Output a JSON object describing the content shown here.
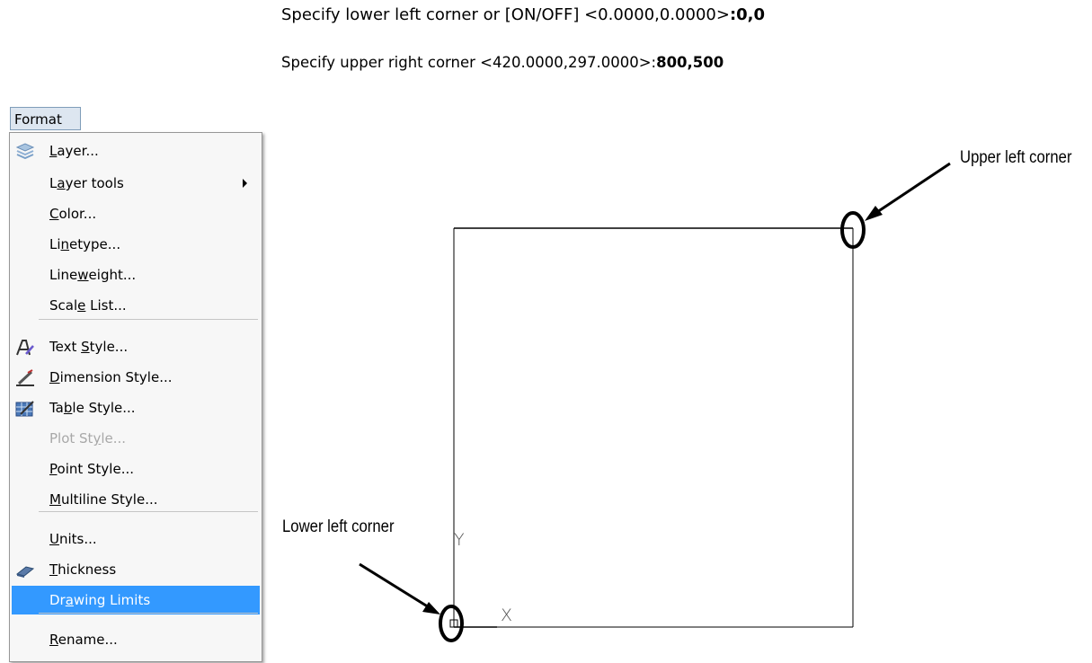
{
  "command": {
    "line1_text": "Specify lower left corner or [ON/OFF] <0.0000,0.0000>",
    "line1_value": ":0,0",
    "line2_text": "Specify upper right corner <420.0000,297.0000>:",
    "line2_value": "800,500"
  },
  "menubar": {
    "format_label": "Format"
  },
  "menu": {
    "items": [
      {
        "label": "Layer...",
        "mnemonic": "L",
        "icon": "layers-icon",
        "enabled": true
      },
      {
        "label": "Layer tools",
        "mnemonic": "a",
        "has_submenu": true,
        "enabled": true
      },
      {
        "label": "Color...",
        "mnemonic": "C",
        "enabled": true
      },
      {
        "label": "Linetype...",
        "mnemonic": "n",
        "enabled": true
      },
      {
        "label": "Lineweight...",
        "mnemonic": "w",
        "enabled": true
      },
      {
        "label": "Scale List...",
        "mnemonic": "e",
        "enabled": true
      },
      {
        "label": "Text Style...",
        "mnemonic": "S",
        "icon": "text-style-icon",
        "enabled": true
      },
      {
        "label": "Dimension Style...",
        "mnemonic": "D",
        "icon": "dimension-style-icon",
        "enabled": true
      },
      {
        "label": "Table Style...",
        "mnemonic": "b",
        "icon": "table-style-icon",
        "enabled": true
      },
      {
        "label": "Plot Style...",
        "mnemonic": "y",
        "enabled": false
      },
      {
        "label": "Point Style...",
        "mnemonic": "P",
        "enabled": true
      },
      {
        "label": "Multiline Style...",
        "mnemonic": "M",
        "enabled": true
      },
      {
        "label": "Units...",
        "mnemonic": "U",
        "enabled": true
      },
      {
        "label": "Thickness",
        "mnemonic": "T",
        "icon": "thickness-icon",
        "enabled": true
      },
      {
        "label": "Drawing Limits",
        "mnemonic": "a",
        "enabled": true,
        "highlighted": true
      },
      {
        "label": "Rename...",
        "mnemonic": "R",
        "enabled": true
      }
    ],
    "highlight_color": "#3399ff"
  },
  "annotations": {
    "upper_label": "Upper left corner",
    "lower_label": "Lower left corner",
    "axis_y": "Y",
    "axis_x": "X"
  }
}
